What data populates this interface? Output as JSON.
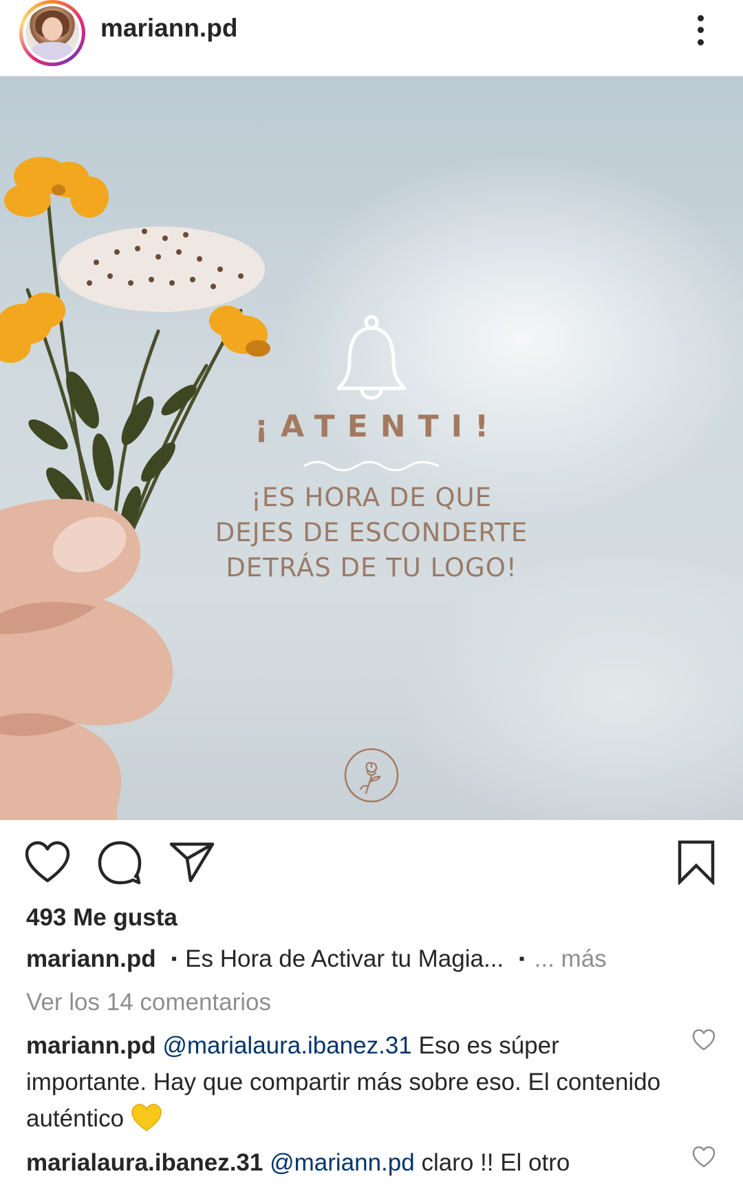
{
  "header": {
    "username": "mariann.pd"
  },
  "post": {
    "image_text": {
      "headline": "¡ATENTI!",
      "lines": [
        "¡ES HORA DE QUE",
        "DEJES DE ESCONDERTE",
        "DETRÁS DE TU LOGO!"
      ]
    },
    "accent_color": "#a5795f"
  },
  "actions": {
    "like_icon": "heart-outline-icon",
    "comment_icon": "comment-bubble-icon",
    "share_icon": "paper-plane-icon",
    "save_icon": "bookmark-icon"
  },
  "likes": {
    "text": "493 Me gusta"
  },
  "caption": {
    "username": "mariann.pd",
    "bullet": "▪",
    "text": "Es Hora de Activar tu Magia...",
    "bullet2": "▪",
    "more": "... más"
  },
  "view_comments": "Ver los 14 comentarios",
  "comments": [
    {
      "username": "mariann.pd",
      "mention": "@marialaura.ibanez.31",
      "text": " Eso es súper importante. Hay que compartir más sobre eso. El contenido auténtico ",
      "emoji": "yellow-heart-emoji"
    },
    {
      "username": "marialaura.ibanez.31",
      "mention": "@mariann.pd",
      "text": " claro !! El otro"
    }
  ]
}
